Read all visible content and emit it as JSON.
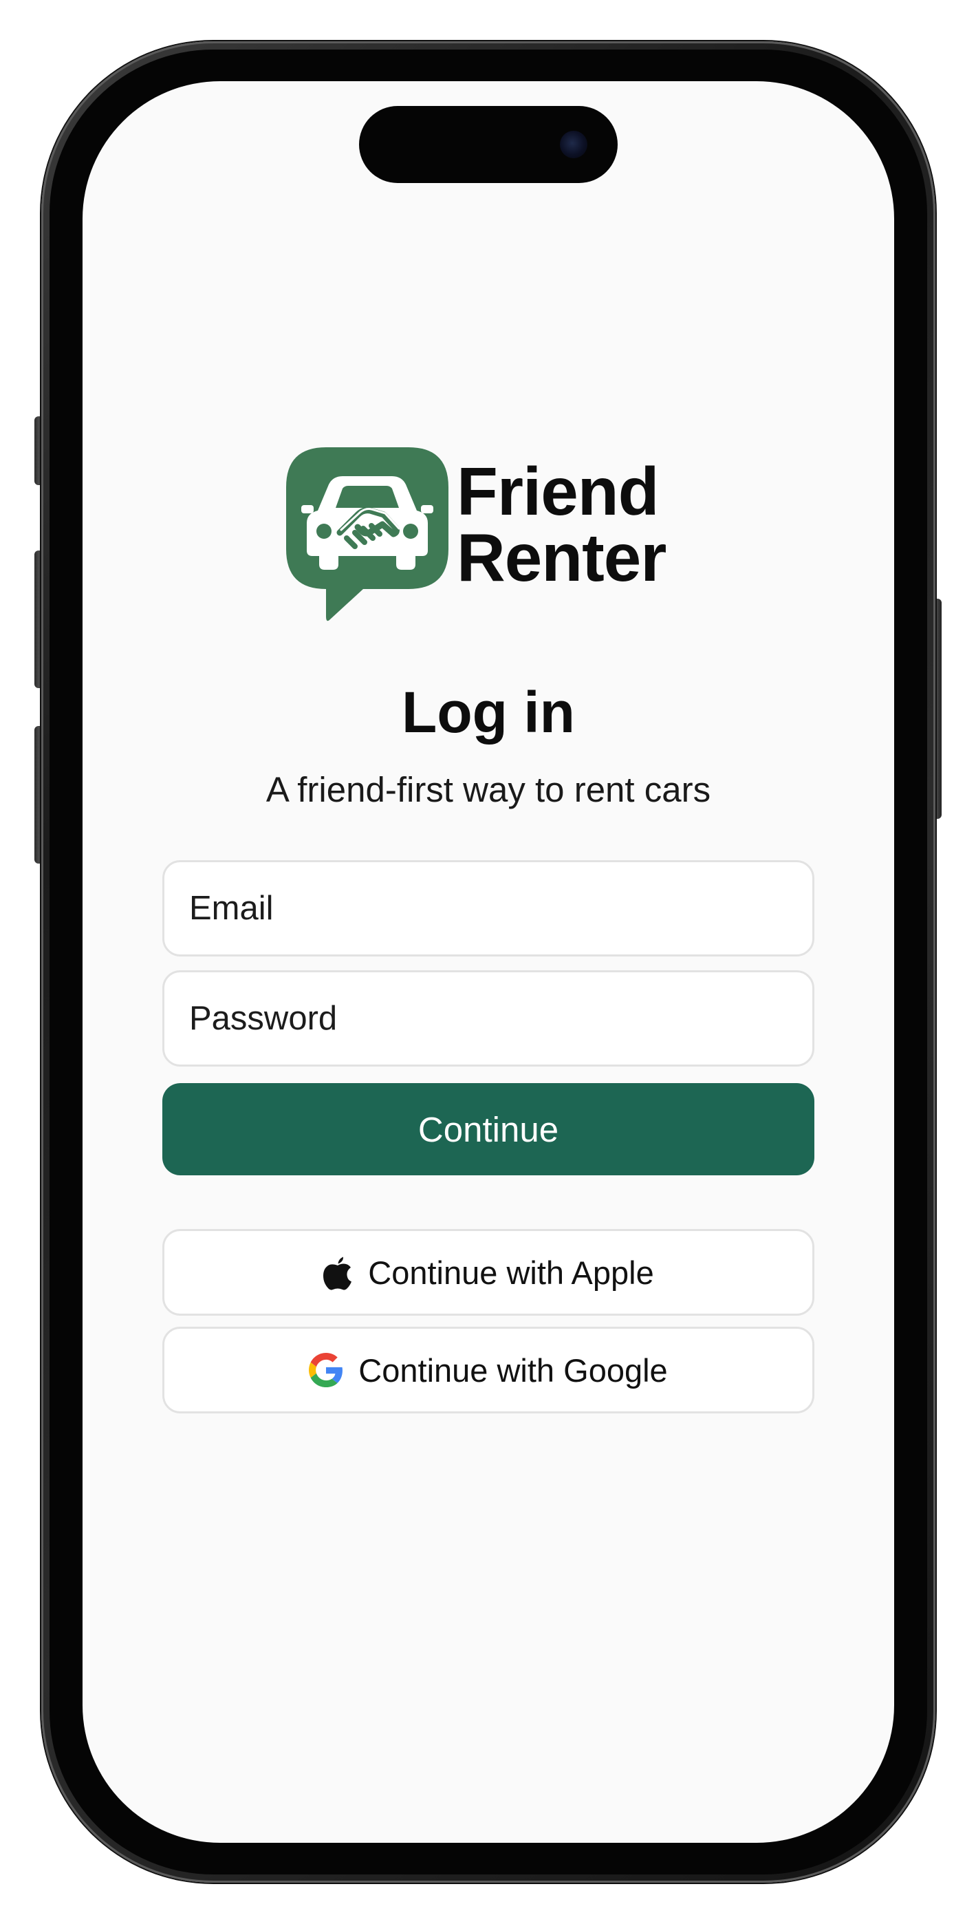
{
  "app": {
    "brand_line1": "Friend",
    "brand_line2": "Renter",
    "brand_color": "#3f7a55",
    "logo_icon": "car-handshake-icon"
  },
  "login": {
    "title": "Log in",
    "subtitle": "A friend-first way to rent cars",
    "email_placeholder": "Email",
    "password_placeholder": "Password",
    "continue_label": "Continue",
    "continue_color": "#1d6653"
  },
  "social": {
    "apple_label": "Continue with Apple",
    "apple_icon": "apple-icon",
    "google_label": "Continue with Google",
    "google_icon": "google-icon"
  }
}
